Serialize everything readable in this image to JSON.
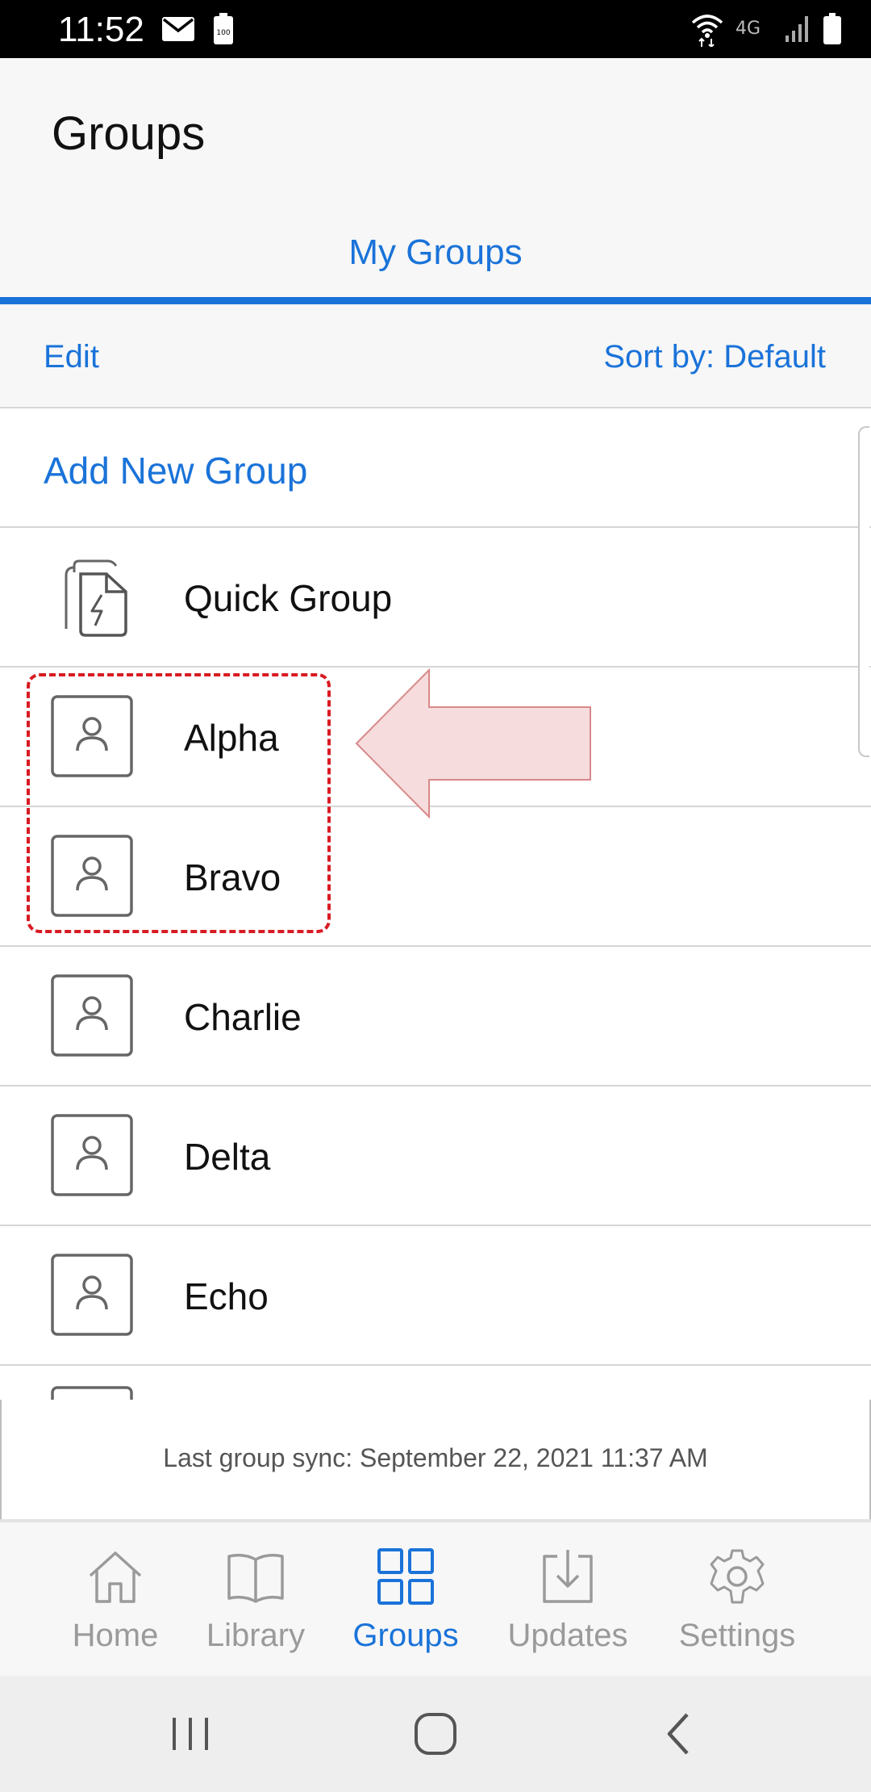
{
  "status_bar": {
    "time": "11:52",
    "icons": [
      "mail-icon",
      "battery-saver-icon",
      "wifi-icon",
      "4g-icon",
      "signal-icon",
      "battery-icon"
    ],
    "battery_saver_text": "100",
    "network_text": "4G"
  },
  "header": {
    "title": "Groups"
  },
  "tabs": [
    {
      "label": "My Groups",
      "active": true
    }
  ],
  "toolbar": {
    "edit_label": "Edit",
    "sort_label": "Sort by: Default"
  },
  "list": {
    "add_label": "Add New Group",
    "items": [
      {
        "label": "Quick Group",
        "icon": "quick-group-icon"
      },
      {
        "label": "Alpha",
        "icon": "person-icon"
      },
      {
        "label": "Bravo",
        "icon": "person-icon"
      },
      {
        "label": "Charlie",
        "icon": "person-icon"
      },
      {
        "label": "Delta",
        "icon": "person-icon"
      },
      {
        "label": "Echo",
        "icon": "person-icon"
      }
    ]
  },
  "sync": {
    "text": "Last group sync: September 22, 2021 11:37 AM"
  },
  "bottom_nav": {
    "items": [
      {
        "label": "Home",
        "icon": "home-icon",
        "active": false
      },
      {
        "label": "Library",
        "icon": "book-icon",
        "active": false
      },
      {
        "label": "Groups",
        "icon": "grid-icon",
        "active": true
      },
      {
        "label": "Updates",
        "icon": "download-icon",
        "active": false
      },
      {
        "label": "Settings",
        "icon": "gear-icon",
        "active": false
      }
    ]
  },
  "system_nav": {
    "icons": [
      "recents-icon",
      "home-button-icon",
      "back-icon"
    ]
  },
  "colors": {
    "accent": "#1a73d9",
    "highlight": "#d81b23",
    "arrow_fill": "#f6dcdc",
    "arrow_stroke": "#d9898b"
  }
}
